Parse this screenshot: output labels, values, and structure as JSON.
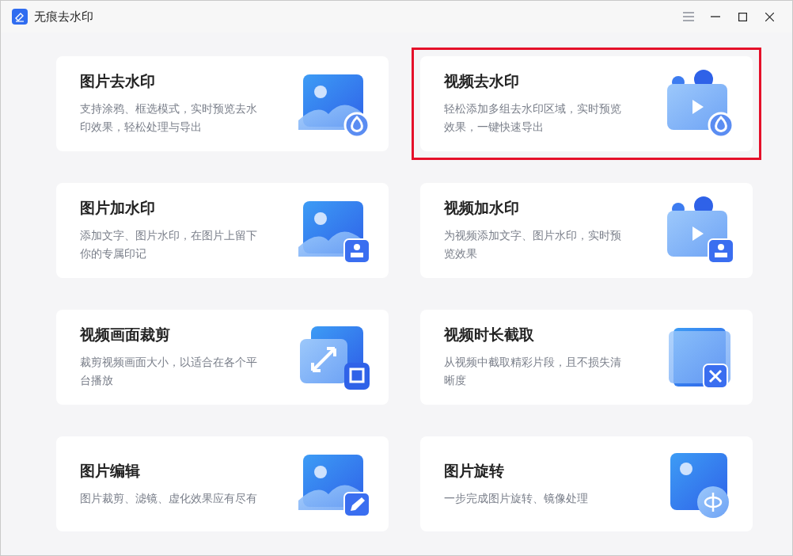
{
  "window": {
    "title": "无痕去水印"
  },
  "cards": [
    {
      "title": "图片去水印",
      "description": "支持涂鸦、框选模式，实时预览去水印效果，轻松处理与导出",
      "kind": "image-remove",
      "highlighted": false
    },
    {
      "title": "视频去水印",
      "description": "轻松添加多组去水印区域，实时预览效果，一键快速导出",
      "kind": "video-remove",
      "highlighted": true
    },
    {
      "title": "图片加水印",
      "description": "添加文字、图片水印，在图片上留下你的专属印记",
      "kind": "image-add",
      "highlighted": false
    },
    {
      "title": "视频加水印",
      "description": "为视频添加文字、图片水印，实时预览效果",
      "kind": "video-add",
      "highlighted": false
    },
    {
      "title": "视频画面裁剪",
      "description": "裁剪视频画面大小，以适合在各个平台播放",
      "kind": "crop",
      "highlighted": false
    },
    {
      "title": "视频时长截取",
      "description": "从视频中截取精彩片段，且不损失清晰度",
      "kind": "trim",
      "highlighted": false
    },
    {
      "title": "图片编辑",
      "description": "图片裁剪、滤镜、虚化效果应有尽有",
      "kind": "edit",
      "highlighted": false
    },
    {
      "title": "图片旋转",
      "description": "一步完成图片旋转、镜像处理",
      "kind": "rotate",
      "highlighted": false
    }
  ]
}
